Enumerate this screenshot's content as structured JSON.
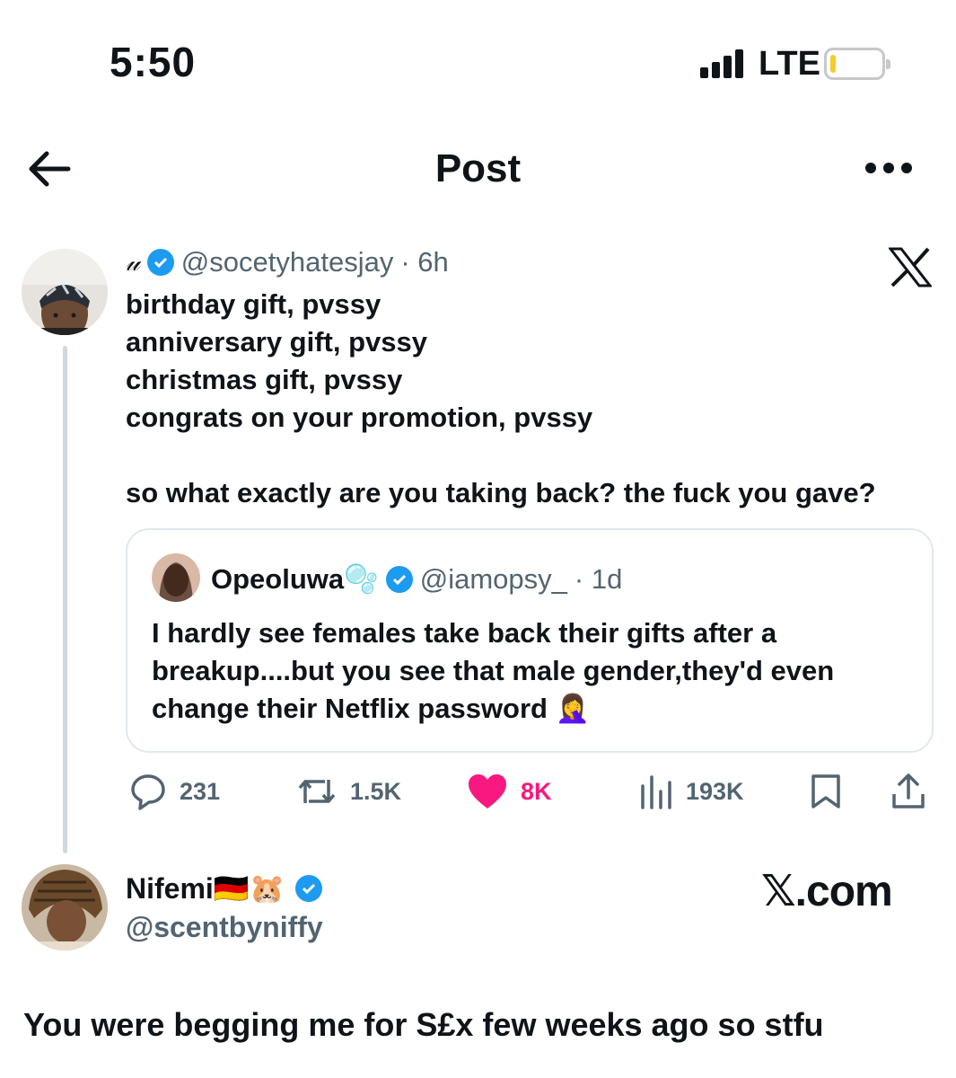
{
  "status_bar": {
    "time": "5:50",
    "network": "LTE",
    "battery_level": 0.1
  },
  "header": {
    "title": "Post",
    "back_icon": "arrow-left-icon",
    "more_icon": "ellipsis-icon"
  },
  "tweet": {
    "display_name": "𝓊",
    "handle": "@socetyhatesjay",
    "time": "· 6h",
    "lines": [
      "birthday gift, pvssy",
      "anniversary gift, pvssy",
      "christmas gift, pvssy",
      "congrats on your promotion, pvssy",
      "",
      "so what exactly are you taking back? the fuck you gave?"
    ],
    "quote": {
      "name": "Opeoluwa🫧",
      "handle": "@iamopsy_",
      "time": "· 1d",
      "text": "I hardly see females take back their gifts after a breakup....but you see that male gender,they'd even change their Netflix password 🤦‍♀️"
    },
    "stats": {
      "replies": "231",
      "reposts": "1.5K",
      "likes": "8K",
      "views": "193K"
    },
    "colors": {
      "verified": "#1d9bf0",
      "like": "#f91880",
      "muted": "#536471"
    }
  },
  "reply": {
    "display_name": "Nifemi🇩🇪🐹",
    "handle": "@scentbyniffy",
    "text": "You were begging me for S£x few weeks ago so stfu"
  },
  "watermark": "𝕏.com"
}
